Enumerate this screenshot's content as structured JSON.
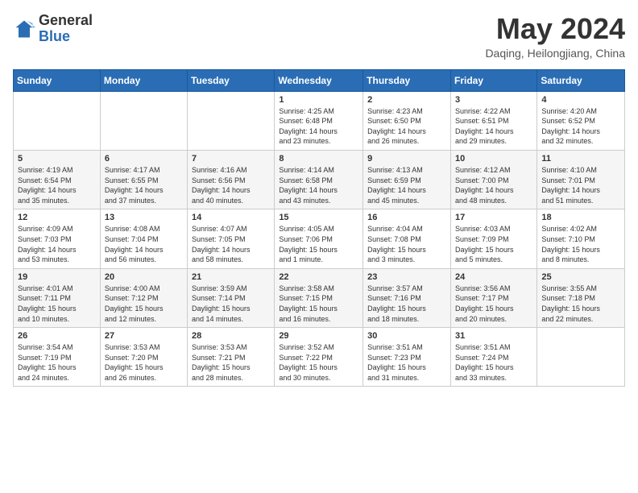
{
  "header": {
    "logo_general": "General",
    "logo_blue": "Blue",
    "month_title": "May 2024",
    "location": "Daqing, Heilongjiang, China"
  },
  "weekdays": [
    "Sunday",
    "Monday",
    "Tuesday",
    "Wednesday",
    "Thursday",
    "Friday",
    "Saturday"
  ],
  "weeks": [
    [
      {
        "day": "",
        "info": ""
      },
      {
        "day": "",
        "info": ""
      },
      {
        "day": "",
        "info": ""
      },
      {
        "day": "1",
        "info": "Sunrise: 4:25 AM\nSunset: 6:48 PM\nDaylight: 14 hours\nand 23 minutes."
      },
      {
        "day": "2",
        "info": "Sunrise: 4:23 AM\nSunset: 6:50 PM\nDaylight: 14 hours\nand 26 minutes."
      },
      {
        "day": "3",
        "info": "Sunrise: 4:22 AM\nSunset: 6:51 PM\nDaylight: 14 hours\nand 29 minutes."
      },
      {
        "day": "4",
        "info": "Sunrise: 4:20 AM\nSunset: 6:52 PM\nDaylight: 14 hours\nand 32 minutes."
      }
    ],
    [
      {
        "day": "5",
        "info": "Sunrise: 4:19 AM\nSunset: 6:54 PM\nDaylight: 14 hours\nand 35 minutes."
      },
      {
        "day": "6",
        "info": "Sunrise: 4:17 AM\nSunset: 6:55 PM\nDaylight: 14 hours\nand 37 minutes."
      },
      {
        "day": "7",
        "info": "Sunrise: 4:16 AM\nSunset: 6:56 PM\nDaylight: 14 hours\nand 40 minutes."
      },
      {
        "day": "8",
        "info": "Sunrise: 4:14 AM\nSunset: 6:58 PM\nDaylight: 14 hours\nand 43 minutes."
      },
      {
        "day": "9",
        "info": "Sunrise: 4:13 AM\nSunset: 6:59 PM\nDaylight: 14 hours\nand 45 minutes."
      },
      {
        "day": "10",
        "info": "Sunrise: 4:12 AM\nSunset: 7:00 PM\nDaylight: 14 hours\nand 48 minutes."
      },
      {
        "day": "11",
        "info": "Sunrise: 4:10 AM\nSunset: 7:01 PM\nDaylight: 14 hours\nand 51 minutes."
      }
    ],
    [
      {
        "day": "12",
        "info": "Sunrise: 4:09 AM\nSunset: 7:03 PM\nDaylight: 14 hours\nand 53 minutes."
      },
      {
        "day": "13",
        "info": "Sunrise: 4:08 AM\nSunset: 7:04 PM\nDaylight: 14 hours\nand 56 minutes."
      },
      {
        "day": "14",
        "info": "Sunrise: 4:07 AM\nSunset: 7:05 PM\nDaylight: 14 hours\nand 58 minutes."
      },
      {
        "day": "15",
        "info": "Sunrise: 4:05 AM\nSunset: 7:06 PM\nDaylight: 15 hours\nand 1 minute."
      },
      {
        "day": "16",
        "info": "Sunrise: 4:04 AM\nSunset: 7:08 PM\nDaylight: 15 hours\nand 3 minutes."
      },
      {
        "day": "17",
        "info": "Sunrise: 4:03 AM\nSunset: 7:09 PM\nDaylight: 15 hours\nand 5 minutes."
      },
      {
        "day": "18",
        "info": "Sunrise: 4:02 AM\nSunset: 7:10 PM\nDaylight: 15 hours\nand 8 minutes."
      }
    ],
    [
      {
        "day": "19",
        "info": "Sunrise: 4:01 AM\nSunset: 7:11 PM\nDaylight: 15 hours\nand 10 minutes."
      },
      {
        "day": "20",
        "info": "Sunrise: 4:00 AM\nSunset: 7:12 PM\nDaylight: 15 hours\nand 12 minutes."
      },
      {
        "day": "21",
        "info": "Sunrise: 3:59 AM\nSunset: 7:14 PM\nDaylight: 15 hours\nand 14 minutes."
      },
      {
        "day": "22",
        "info": "Sunrise: 3:58 AM\nSunset: 7:15 PM\nDaylight: 15 hours\nand 16 minutes."
      },
      {
        "day": "23",
        "info": "Sunrise: 3:57 AM\nSunset: 7:16 PM\nDaylight: 15 hours\nand 18 minutes."
      },
      {
        "day": "24",
        "info": "Sunrise: 3:56 AM\nSunset: 7:17 PM\nDaylight: 15 hours\nand 20 minutes."
      },
      {
        "day": "25",
        "info": "Sunrise: 3:55 AM\nSunset: 7:18 PM\nDaylight: 15 hours\nand 22 minutes."
      }
    ],
    [
      {
        "day": "26",
        "info": "Sunrise: 3:54 AM\nSunset: 7:19 PM\nDaylight: 15 hours\nand 24 minutes."
      },
      {
        "day": "27",
        "info": "Sunrise: 3:53 AM\nSunset: 7:20 PM\nDaylight: 15 hours\nand 26 minutes."
      },
      {
        "day": "28",
        "info": "Sunrise: 3:53 AM\nSunset: 7:21 PM\nDaylight: 15 hours\nand 28 minutes."
      },
      {
        "day": "29",
        "info": "Sunrise: 3:52 AM\nSunset: 7:22 PM\nDaylight: 15 hours\nand 30 minutes."
      },
      {
        "day": "30",
        "info": "Sunrise: 3:51 AM\nSunset: 7:23 PM\nDaylight: 15 hours\nand 31 minutes."
      },
      {
        "day": "31",
        "info": "Sunrise: 3:51 AM\nSunset: 7:24 PM\nDaylight: 15 hours\nand 33 minutes."
      },
      {
        "day": "",
        "info": ""
      }
    ]
  ]
}
